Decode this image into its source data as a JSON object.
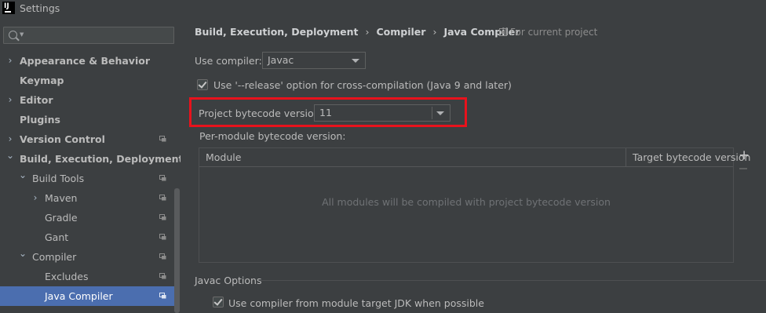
{
  "window": {
    "title": "Settings",
    "logo_text": "IJ",
    "close_glyph": "✕"
  },
  "sidebar": {
    "search": {
      "value": "",
      "placeholder": ""
    },
    "items": [
      {
        "label": "Appearance & Behavior",
        "chevron": "›",
        "bold": true
      },
      {
        "label": "Keymap",
        "bold": true
      },
      {
        "label": "Editor",
        "chevron": "›",
        "bold": true
      },
      {
        "label": "Plugins",
        "bold": true
      },
      {
        "label": "Version Control",
        "chevron": "›",
        "bold": true,
        "project_icon": true
      },
      {
        "label": "Build, Execution, Deployment",
        "chevron": "⌄",
        "bold": true
      },
      {
        "label": "Build Tools",
        "chevron": "⌄",
        "project_icon": true
      },
      {
        "label": "Maven",
        "chevron": "›",
        "project_icon": true
      },
      {
        "label": "Gradle",
        "project_icon": true
      },
      {
        "label": "Gant",
        "project_icon": true
      },
      {
        "label": "Compiler",
        "chevron": "⌄",
        "project_icon": true
      },
      {
        "label": "Excludes",
        "project_icon": true
      },
      {
        "label": "Java Compiler",
        "project_icon": true,
        "selected": true
      }
    ]
  },
  "breadcrumb": {
    "items": [
      "Build, Execution, Deployment",
      "Compiler",
      "Java Compiler"
    ],
    "separator": "›",
    "scope": "For current project"
  },
  "form": {
    "use_compiler_label": "Use compiler:",
    "use_compiler_value": "Javac",
    "release_option_label": "Use '--release' option for cross-compilation (Java 9 and later)",
    "release_option_checked": true,
    "bytecode_version_label": "Project bytecode version:",
    "bytecode_version_value": "11",
    "per_module_label": "Per-module bytecode version:",
    "table": {
      "columns": [
        "Module",
        "Target bytecode version"
      ],
      "empty_text": "All modules will be compiled with project bytecode version",
      "add_glyph": "+"
    },
    "javac_options_title": "Javac Options",
    "module_target_jdk_label": "Use compiler from module target JDK when possible",
    "module_target_jdk_checked": true
  },
  "colors": {
    "background": "#3c3f41",
    "selection": "#4b6eaf",
    "highlight_box": "#e8121c"
  }
}
